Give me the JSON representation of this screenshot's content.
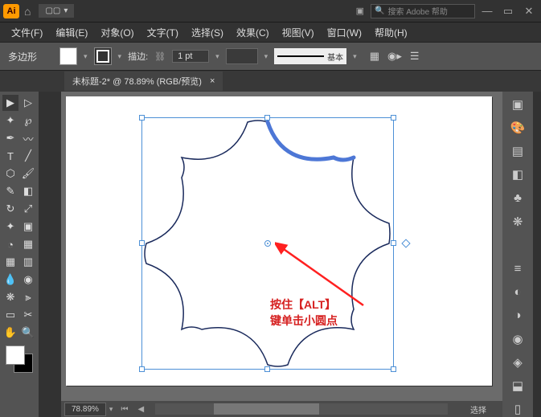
{
  "title": {
    "logo": "Ai"
  },
  "search": {
    "placeholder": "搜索 Adobe 帮助"
  },
  "menu": {
    "file": "文件(F)",
    "edit": "编辑(E)",
    "object": "对象(O)",
    "type": "文字(T)",
    "select": "选择(S)",
    "effect": "效果(C)",
    "view": "视图(V)",
    "window": "窗口(W)",
    "help": "帮助(H)"
  },
  "control": {
    "shape": "多边形",
    "stroke_lbl": "描边:",
    "pt": "1 pt",
    "brush": "基本"
  },
  "tab": {
    "title": "未标题-2* @ 78.89% (RGB/预览)",
    "close": "×"
  },
  "annotation": {
    "line1": "按住【ALT】",
    "line2": "键单击小圆点"
  },
  "status": {
    "zoom": "78.89%",
    "sel": "选择"
  }
}
